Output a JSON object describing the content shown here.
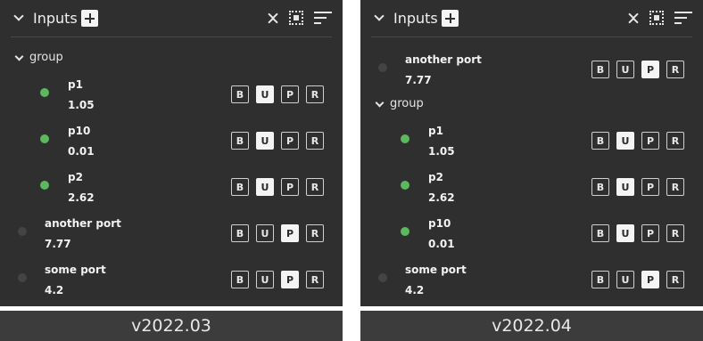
{
  "panels": [
    {
      "title": "Inputs",
      "version": "v2022.03",
      "group_label": "group",
      "ports": [
        {
          "name": "p1",
          "value": "1.05",
          "status": "connected",
          "buttons": [
            "B",
            "U",
            "P",
            "R"
          ],
          "active": "U"
        },
        {
          "name": "p10",
          "value": "0.01",
          "status": "connected",
          "buttons": [
            "B",
            "U",
            "P",
            "R"
          ],
          "active": "U"
        },
        {
          "name": "p2",
          "value": "2.62",
          "status": "connected",
          "buttons": [
            "B",
            "U",
            "P",
            "R"
          ],
          "active": "U"
        },
        {
          "name": "another port",
          "value": "7.77",
          "status": "disconnected",
          "buttons": [
            "B",
            "U",
            "P",
            "R"
          ],
          "active": "P"
        },
        {
          "name": "some port",
          "value": "4.2",
          "status": "disconnected",
          "buttons": [
            "B",
            "U",
            "P",
            "R"
          ],
          "active": "P"
        }
      ]
    },
    {
      "title": "Inputs",
      "version": "v2022.04",
      "group_label": "group",
      "ports": [
        {
          "name": "another port",
          "value": "7.77",
          "status": "disconnected",
          "buttons": [
            "B",
            "U",
            "P",
            "R"
          ],
          "active": "P"
        },
        {
          "name": "p1",
          "value": "1.05",
          "status": "connected",
          "buttons": [
            "B",
            "U",
            "P",
            "R"
          ],
          "active": "U"
        },
        {
          "name": "p2",
          "value": "2.62",
          "status": "connected",
          "buttons": [
            "B",
            "U",
            "P",
            "R"
          ],
          "active": "U"
        },
        {
          "name": "p10",
          "value": "0.01",
          "status": "connected",
          "buttons": [
            "B",
            "U",
            "P",
            "R"
          ],
          "active": "U"
        },
        {
          "name": "some port",
          "value": "4.2",
          "status": "disconnected",
          "buttons": [
            "B",
            "U",
            "P",
            "R"
          ],
          "active": "P"
        }
      ]
    }
  ],
  "colors": {
    "panel_bg": "#2f2f2f",
    "footer_bg": "#3c3c3c",
    "connected_dot": "#5cb85c",
    "disconnected_dot": "#444444"
  },
  "icons": [
    "chevron-down-icon",
    "add-icon",
    "collapse-all-icon",
    "select-all-icon",
    "sort-icon"
  ]
}
